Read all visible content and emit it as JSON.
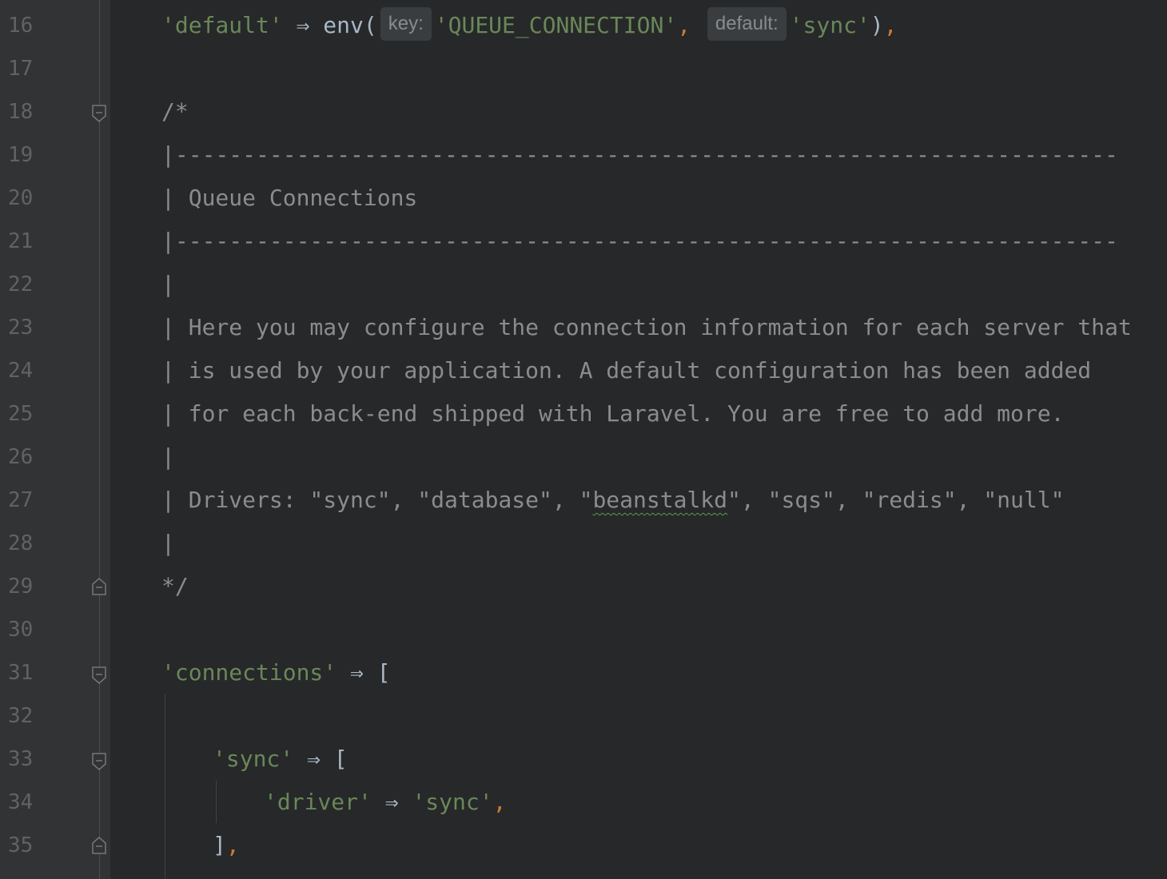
{
  "editor": {
    "line_numbers": [
      "16",
      "17",
      "18",
      "19",
      "20",
      "21",
      "22",
      "23",
      "24",
      "25",
      "26",
      "27",
      "28",
      "29",
      "30",
      "31",
      "32",
      "33",
      "34",
      "35"
    ],
    "lines": {
      "l16": {
        "key": "'default'",
        "arrow": " ⇒ ",
        "func": "env(",
        "hint_key": "key:",
        "arg1": "'QUEUE_CONNECTION'",
        "comma1": ", ",
        "hint_default": "default:",
        "arg2": "'sync'",
        "close": ")",
        "comma2": ","
      },
      "l18": "/*",
      "l19": "|--------------------------------------------------------------------------",
      "l20": "| Queue Connections",
      "l21": "|--------------------------------------------------------------------------",
      "l22": "|",
      "l23": "| Here you may configure the connection information for each server that",
      "l24": "| is used by your application. A default configuration has been added",
      "l25": "| for each back-end shipped with Laravel. You are free to add more.",
      "l26": "|",
      "l27": {
        "prefix": "| Drivers: \"sync\", \"database\", \"",
        "squiggle_word": "beanstalkd",
        "suffix": "\", \"sqs\", \"redis\", \"null\""
      },
      "l28": "|",
      "l29": "*/",
      "l31": {
        "key": "'connections'",
        "arrow": " ⇒ ",
        "bracket": "["
      },
      "l33": {
        "key": "'sync'",
        "arrow": " ⇒ ",
        "bracket": "["
      },
      "l34": {
        "key": "'driver'",
        "arrow": " ⇒ ",
        "value": "'sync'",
        "comma": ","
      },
      "l35": {
        "bracket": "]",
        "comma": ","
      }
    },
    "colors": {
      "background": "#262829",
      "gutter": "#313335",
      "string": "#6a8759",
      "punctuation": "#cc7832",
      "comment": "#8c8c8c",
      "line_number": "#606366"
    }
  }
}
